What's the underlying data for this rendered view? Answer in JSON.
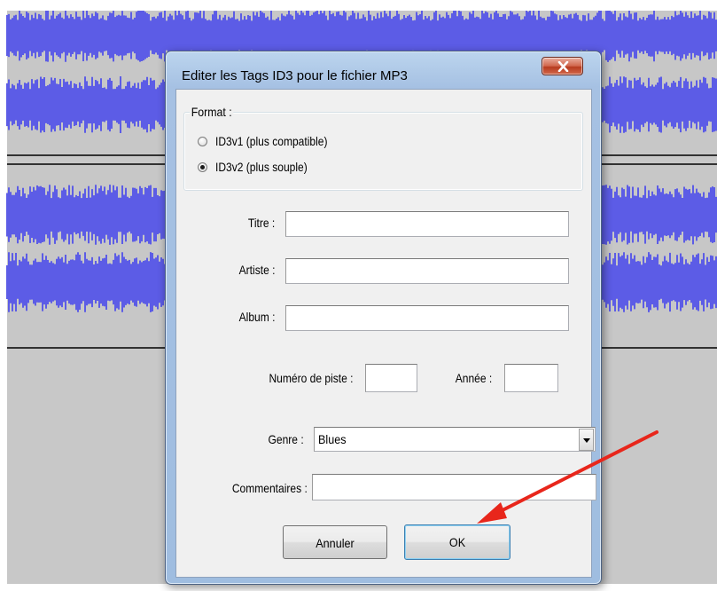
{
  "dialog": {
    "title": "Editer les Tags ID3 pour le fichier MP3",
    "close_icon": "close-icon"
  },
  "format": {
    "label": "Format :",
    "options": [
      {
        "label": "ID3v1 (plus compatible)",
        "selected": false
      },
      {
        "label": "ID3v2 (plus souple)",
        "selected": true
      }
    ]
  },
  "fields": {
    "title": {
      "label": "Titre :",
      "value": ""
    },
    "artist": {
      "label": "Artiste :",
      "value": ""
    },
    "album": {
      "label": "Album :",
      "value": ""
    },
    "track": {
      "label": "Numéro de piste :",
      "value": ""
    },
    "year": {
      "label": "Année :",
      "value": ""
    },
    "genre": {
      "label": "Genre :",
      "value": "Blues"
    },
    "comments": {
      "label": "Commentaires :",
      "value": ""
    }
  },
  "buttons": {
    "cancel": "Annuler",
    "ok": "OK"
  },
  "annotation": {
    "color": "#e8261b",
    "points_to": "ok-button"
  },
  "colors": {
    "waveform": "#5c5ce6",
    "track_bg": "#c7c7c7",
    "title_bar": "#a9c4e4"
  }
}
